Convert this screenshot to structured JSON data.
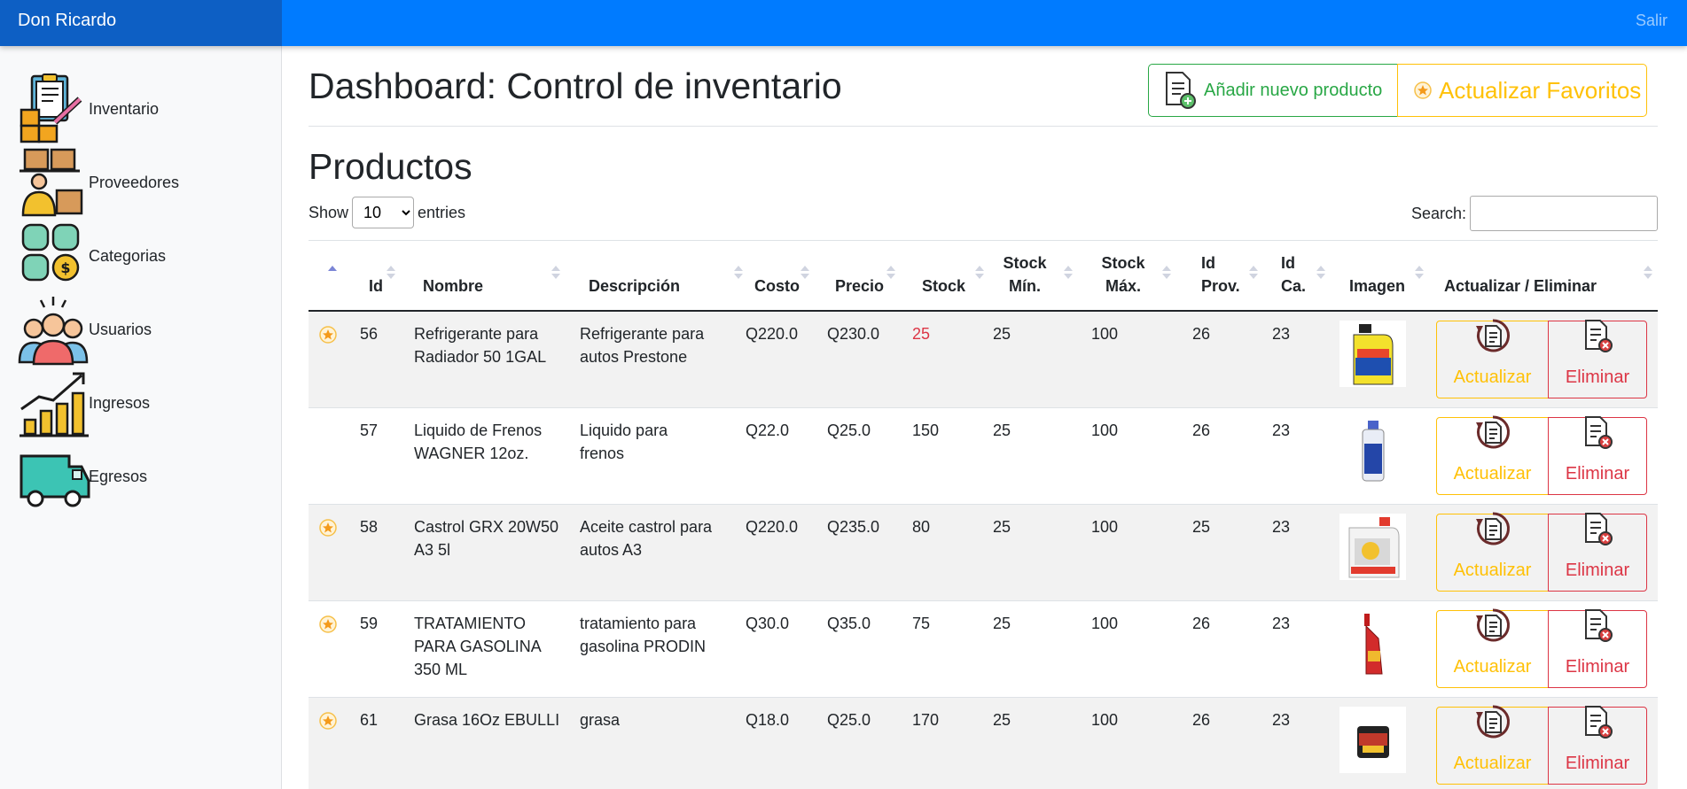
{
  "navbar": {
    "brand": "Don Ricardo",
    "signout": "Salir"
  },
  "sidebar": {
    "items": [
      {
        "label": "Inventario",
        "icon": "inventory-icon"
      },
      {
        "label": "Proveedores",
        "icon": "suppliers-icon"
      },
      {
        "label": "Categorias",
        "icon": "categories-icon"
      },
      {
        "label": "Usuarios",
        "icon": "users-icon"
      },
      {
        "label": "Ingresos",
        "icon": "income-icon"
      },
      {
        "label": "Egresos",
        "icon": "delivery-truck-icon"
      }
    ]
  },
  "header": {
    "title": "Dashboard: Control de inventario",
    "add_label": "Añadir nuevo producto",
    "fav_label": "Actualizar Favoritos"
  },
  "products": {
    "title": "Productos",
    "show_label": "Show",
    "entries_value": "10",
    "entries_label": "entries",
    "search_label": "Search:",
    "search_value": "",
    "columns": {
      "id": "Id",
      "nombre": "Nombre",
      "descripcion": "Descripción",
      "costo": "Costo",
      "precio": "Precio",
      "stock": "Stock",
      "stock_min_1": "Stock",
      "stock_min_2": "Mín.",
      "stock_max_1": "Stock",
      "stock_max_2": "Máx.",
      "id_prov_1": "Id",
      "id_prov_2": "Prov.",
      "id_ca_1": "Id",
      "id_ca_2": "Ca.",
      "imagen": "Imagen",
      "acciones": "Actualizar / Eliminar"
    },
    "update_label": "Actualizar",
    "delete_label": "Eliminar",
    "rows": [
      {
        "favorite": true,
        "id": "56",
        "nombre": "Refrigerante para Radiador 50 1GAL",
        "descripcion": "Refrigerante para autos Prestone",
        "costo": "Q220.0",
        "precio": "Q230.0",
        "stock": "25",
        "stock_low": true,
        "stock_min": "25",
        "stock_max": "100",
        "id_prov": "26",
        "id_ca": "23",
        "image": "coolant-jug-icon"
      },
      {
        "favorite": false,
        "id": "57",
        "nombre": "Liquido de Frenos WAGNER 12oz.",
        "descripcion": "Liquido para frenos",
        "costo": "Q22.0",
        "precio": "Q25.0",
        "stock": "150",
        "stock_low": false,
        "stock_min": "25",
        "stock_max": "100",
        "id_prov": "26",
        "id_ca": "23",
        "image": "brake-fluid-bottle-icon"
      },
      {
        "favorite": true,
        "id": "58",
        "nombre": "Castrol GRX 20W50 A3 5l",
        "descripcion": "Aceite castrol para autos A3",
        "costo": "Q220.0",
        "precio": "Q235.0",
        "stock": "80",
        "stock_low": false,
        "stock_min": "25",
        "stock_max": "100",
        "id_prov": "25",
        "id_ca": "23",
        "image": "oil-jug-icon"
      },
      {
        "favorite": true,
        "id": "59",
        "nombre": "TRATAMIENTO PARA GASOLINA 350 ML",
        "descripcion": "tratamiento para gasolina PRODIN",
        "costo": "Q30.0",
        "precio": "Q35.0",
        "stock": "75",
        "stock_low": false,
        "stock_min": "25",
        "stock_max": "100",
        "id_prov": "26",
        "id_ca": "23",
        "image": "fuel-treatment-bottle-icon"
      },
      {
        "favorite": true,
        "id": "61",
        "nombre": "Grasa 16Oz EBULLI",
        "descripcion": "grasa",
        "costo": "Q18.0",
        "precio": "Q25.0",
        "stock": "170",
        "stock_low": false,
        "stock_min": "25",
        "stock_max": "100",
        "id_prov": "26",
        "id_ca": "23",
        "image": "grease-tub-icon"
      }
    ]
  },
  "colors": {
    "navbar": "#007bff",
    "brand_bg": "#0d5fc4",
    "success": "#28a745",
    "warning": "#ffc107",
    "danger": "#dc3545"
  }
}
